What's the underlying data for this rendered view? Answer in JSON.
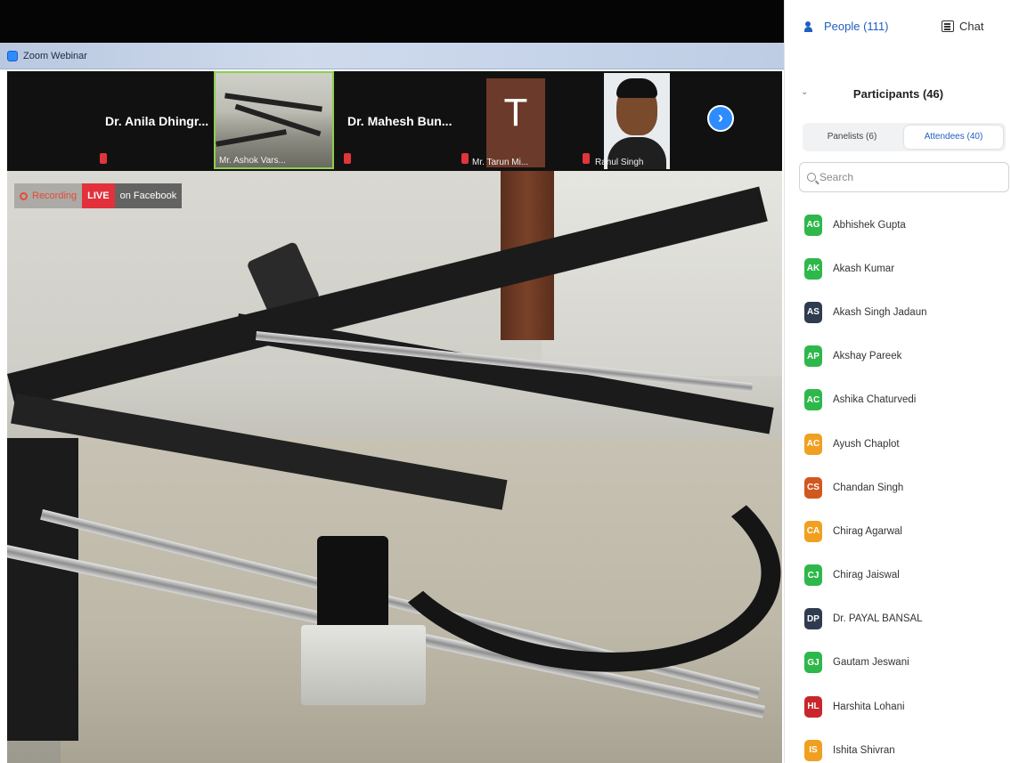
{
  "window": {
    "title": "Zoom Webinar",
    "controls": [
      "–",
      "□",
      "×"
    ]
  },
  "thumbnails": [
    {
      "name": "Dr. Anila Dhingr...",
      "caption": "",
      "muted": true,
      "kind": "name"
    },
    {
      "name": "",
      "caption": "Mr. Ashok Vars...",
      "muted": false,
      "kind": "video"
    },
    {
      "name": "Dr. Mahesh Bun...",
      "caption": "",
      "muted": true,
      "kind": "name"
    },
    {
      "name": "",
      "caption": "Mr. Tarun Mi...",
      "muted": true,
      "kind": "avatar",
      "initial": "T"
    },
    {
      "name": "",
      "caption": "Rahul Singh",
      "muted": true,
      "kind": "photo"
    }
  ],
  "next_button": "›",
  "recording": {
    "recording_label": "Recording",
    "live_label": "LIVE",
    "platform_label": "on Facebook"
  },
  "panel": {
    "tabs": {
      "people": "People (111)",
      "chat": "Chat"
    },
    "title": "Participants (46)",
    "segments": {
      "panelists": "Panelists (6)",
      "attendees": "Attendees (40)"
    },
    "search_placeholder": "Search",
    "participants": [
      {
        "initials": "AG",
        "name": "Abhishek Gupta",
        "color": "#2eb84b"
      },
      {
        "initials": "AK",
        "name": "Akash Kumar",
        "color": "#2eb84b"
      },
      {
        "initials": "AS",
        "name": "Akash Singh Jadaun",
        "color": "#2f3b4f"
      },
      {
        "initials": "AP",
        "name": "Akshay Pareek",
        "color": "#2eb84b"
      },
      {
        "initials": "AC",
        "name": "Ashika Chaturvedi",
        "color": "#2eb84b"
      },
      {
        "initials": "AC",
        "name": "Ayush Chaplot",
        "color": "#f0a020"
      },
      {
        "initials": "CS",
        "name": "Chandan Singh",
        "color": "#d1581f"
      },
      {
        "initials": "CA",
        "name": "Chirag Agarwal",
        "color": "#f0a020"
      },
      {
        "initials": "CJ",
        "name": "Chirag Jaiswal",
        "color": "#2eb84b"
      },
      {
        "initials": "DP",
        "name": "Dr. PAYAL BANSAL",
        "color": "#2f3b4f"
      },
      {
        "initials": "GJ",
        "name": "Gautam Jeswani",
        "color": "#2eb84b"
      },
      {
        "initials": "HL",
        "name": "Harshita Lohani",
        "color": "#c8262c"
      },
      {
        "initials": "IS",
        "name": "Ishita Shivran",
        "color": "#f0a020"
      }
    ]
  }
}
